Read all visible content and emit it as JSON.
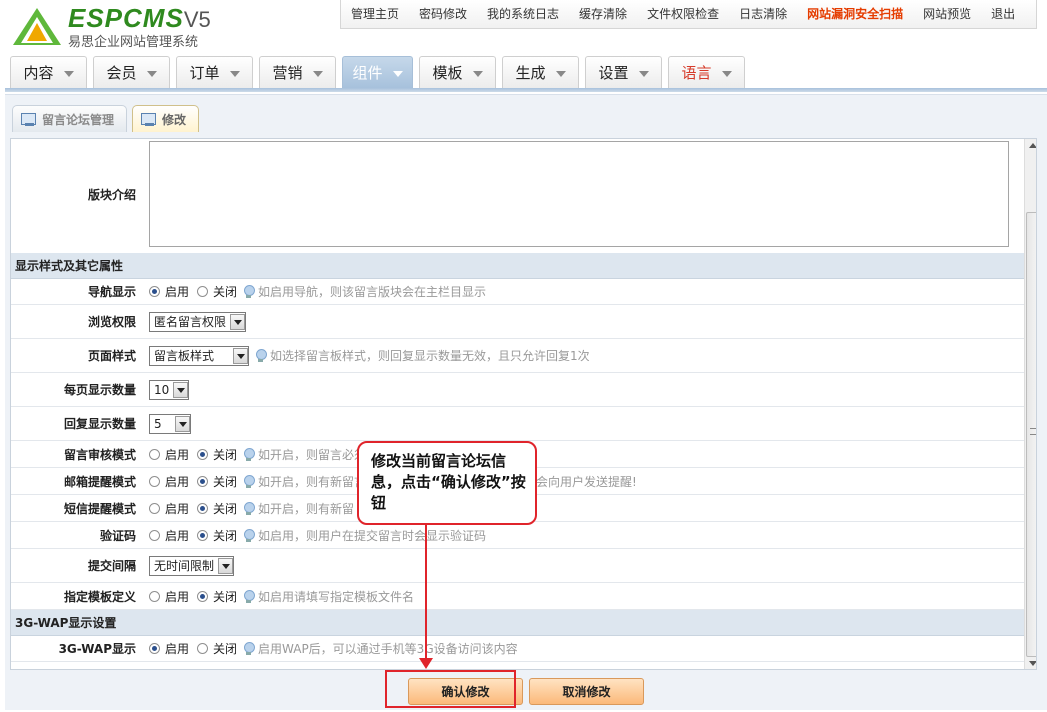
{
  "brand": {
    "logo": "ESPCMS",
    "version": "V5",
    "subtitle": "易思企业网站管理系统"
  },
  "topnav": [
    "管理主页",
    "密码修改",
    "我的系统日志",
    "缓存清除",
    "文件权限检查",
    "日志清除",
    "网站漏洞安全扫描",
    "网站预览",
    "退出"
  ],
  "mainnav": [
    "内容",
    "会员",
    "订单",
    "营销",
    "组件",
    "模板",
    "生成",
    "设置",
    "语言"
  ],
  "active_main": "组件",
  "subtabs": [
    "留言论坛管理",
    "修改"
  ],
  "form": {
    "intro_label": "版块介绍",
    "section1": "显示样式及其它属性",
    "nav_label": "导航显示",
    "nav_hint": "如启用导航，则该留言版块会在主栏目显示",
    "browse_label": "浏览权限",
    "browse_value": "匿名留言权限",
    "style_label": "页面样式",
    "style_value": "留言板样式",
    "style_hint": "如选择留言板样式，则回复显示数量无效，且只允许回复1次",
    "perpage_label": "每页显示数量",
    "perpage_value": "10",
    "reply_label": "回复显示数量",
    "reply_value": "5",
    "audit_label": "留言审核模式",
    "audit_hint": "如开启，则留言必须",
    "mail_label": "邮箱提醒模式",
    "mail_hint": "如开启，则有新留言",
    "mail_hint_tail": "会向用户发送提醒!",
    "sms_label": "短信提醒模式",
    "sms_hint": "如开启，则有新留",
    "captcha_label": "验证码",
    "captcha_hint": "如启用，则用户在提交留言时会显示验证码",
    "interval_label": "提交间隔",
    "interval_value": "无时间限制",
    "tpl_label": "指定模板定义",
    "tpl_hint": "如启用请填写指定模板文件名",
    "section2": "3G-WAP显示设置",
    "wap_label": "3G-WAP显示",
    "wap_hint": "启用WAP后，可以通过手机等3G设备访问该内容",
    "on": "启用",
    "off": "关闭"
  },
  "buttons": {
    "confirm": "确认修改",
    "cancel": "取消修改"
  },
  "callout": "修改当前留言论坛信息，点击“确认修改”按钮",
  "colors": {
    "accent_red": "#e0242b",
    "brand_green": "#2f8a1f"
  }
}
